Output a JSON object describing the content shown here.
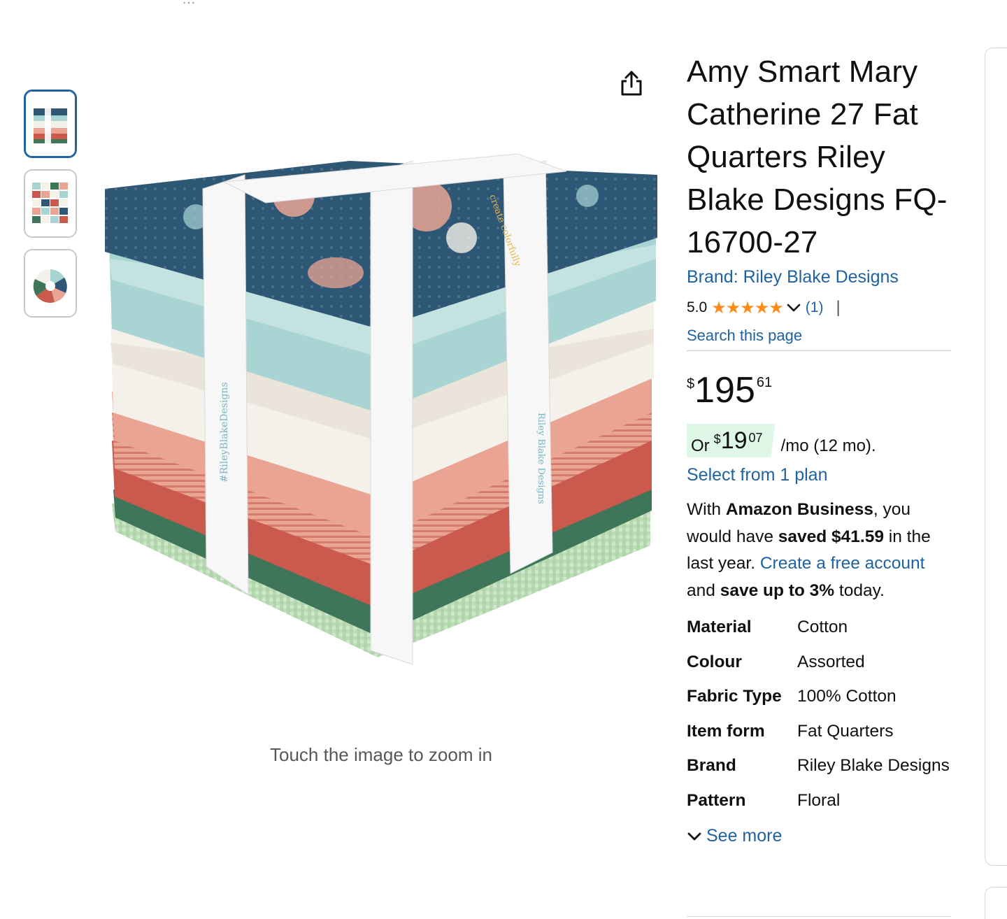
{
  "product": {
    "title": "Amy Smart Mary Catherine 27 Fat Quarters Riley Blake Designs FQ-16700-27",
    "brand_link": "Brand: Riley Blake Designs",
    "rating": "5.0",
    "stars": "★★★★★",
    "rating_count": "(1)",
    "separator": "|",
    "search_page": "Search this page"
  },
  "price": {
    "symbol": "$",
    "whole": "195",
    "fraction": "61"
  },
  "installment": {
    "or": "Or",
    "symbol": "$",
    "whole": "19",
    "fraction": "07",
    "rest": "/mo (12 mo).",
    "select_plan": "Select from 1 plan"
  },
  "business": {
    "p1": "With ",
    "b1": "Amazon Business",
    "p2": ", you would have ",
    "b2": "saved $41.59",
    "p3": " in the last year. ",
    "link": "Create a free account",
    "p4": " and ",
    "b3": "save up to 3%",
    "p5": " today."
  },
  "specs": [
    {
      "key": "Material",
      "value": "Cotton"
    },
    {
      "key": "Colour",
      "value": "Assorted"
    },
    {
      "key": "Fabric Type",
      "value": "100% Cotton"
    },
    {
      "key": "Item form",
      "value": "Fat Quarters"
    },
    {
      "key": "Brand",
      "value": "Riley Blake Designs"
    },
    {
      "key": "Pattern",
      "value": "Floral"
    }
  ],
  "see_more": "See more",
  "zoom_hint": "Touch the image to zoom in",
  "image": {
    "band_text_1": "#RileyBlakeDesigns",
    "band_text_2": "create colorfully",
    "band_text_3": "Riley Blake Designs"
  },
  "colors": {
    "link": "#2162a1",
    "star": "#ff8c1a",
    "installment_bg": "#dff7e7",
    "navy_fabric": "#2e5675",
    "aqua_fabric": "#a9d4d4",
    "cream_fabric": "#f4f1ea",
    "pink_fabric": "#e9a493",
    "red_fabric": "#c95a4d",
    "green_fabric": "#3f7558"
  }
}
